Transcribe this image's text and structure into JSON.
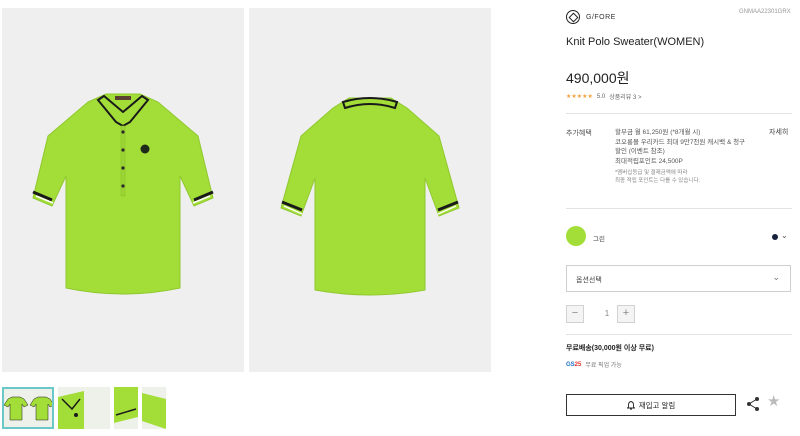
{
  "brand": {
    "name": "G/FORE",
    "sku": "GNMAA22301GRX"
  },
  "product": {
    "title": "Knit Polo Sweater(WOMEN)",
    "price": "490,000원",
    "rating": {
      "stars": "★★★★★",
      "score": "5.0",
      "reviews_link": "상품리뷰 3 >"
    }
  },
  "benefits": {
    "label": "추가혜택",
    "lines": [
      "할부금 월 61,250원 (*8개월 시)",
      "코오롱몰 우리카드 최대 9만7천원 캐시백 & 청구",
      "할인 (이벤트 참조)",
      "최대적립포인트 24,500P"
    ],
    "notes": [
      "*멤버십등급 및 결제금액에 따라",
      "최종 적립 포인트는 다를 수 있습니다."
    ],
    "detail_link": "자세히"
  },
  "color_option": {
    "label": "그린",
    "selected_color": "#a3de38",
    "other_color": "#18213a",
    "more_icon": "chevron-down-icon"
  },
  "option_select": {
    "label": "옵션선택"
  },
  "quantity": {
    "minus": "−",
    "value": "1",
    "plus": "+"
  },
  "shipping": {
    "text": "무료배송(30,000원 이상 무료)",
    "gs_logo": "GS",
    "gs_logo_num": "25",
    "gs_text": "무료 픽업 가능"
  },
  "actions": {
    "restock_label": "재입고 알림",
    "restock_icon": "bell-icon",
    "share_icon": "share-icon",
    "wishlist_icon": "star-icon",
    "wishlist_glyph": "★"
  },
  "thumbnails": [
    {
      "name": "front-back",
      "active": true
    },
    {
      "name": "detail-collar",
      "active": false
    },
    {
      "name": "detail-sleeve",
      "active": false
    },
    {
      "name": "detail-hem",
      "active": false
    }
  ]
}
